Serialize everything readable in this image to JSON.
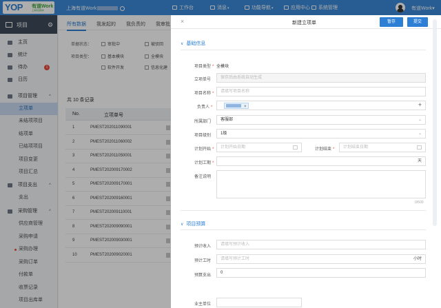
{
  "topbar": {
    "logo_text": "YOP",
    "logo_brand": "有道Work",
    "logo_sub": "上海有道软件",
    "company": "上海有道Work",
    "nav": [
      {
        "label": "工作台",
        "icon": "desktop-icon"
      },
      {
        "label": "消息",
        "icon": "bell-icon"
      },
      {
        "label": "功能导航",
        "icon": "grid-icon"
      },
      {
        "label": "应用中心",
        "icon": "apps-icon"
      },
      {
        "label": "系统管理",
        "icon": "gear-icon"
      }
    ],
    "username": "有道Work",
    "dropdown_glyph": "▾"
  },
  "sidebar": {
    "title": "项目",
    "items": [
      {
        "label": "主页",
        "icon": "home-icon"
      },
      {
        "label": "统计",
        "icon": "chart-icon"
      },
      {
        "label": "待办",
        "icon": "todo-icon",
        "badge": "1"
      },
      {
        "label": "日历",
        "icon": "calendar-icon"
      },
      {
        "label": "项目管理",
        "icon": "folder-icon",
        "caret": "^"
      },
      {
        "label": "立项单",
        "sub": true,
        "active": true
      },
      {
        "label": "未结项项目",
        "sub": true
      },
      {
        "label": "结项单",
        "sub": true
      },
      {
        "label": "已结项项目",
        "sub": true
      },
      {
        "label": "项目变更",
        "sub": true
      },
      {
        "label": "项目汇总",
        "sub": true
      },
      {
        "label": "项目支出",
        "icon": "money-icon",
        "caret": "^"
      },
      {
        "label": "支出",
        "sub": true
      },
      {
        "label": "采购管理",
        "icon": "cart-icon",
        "caret": "^"
      },
      {
        "label": "供应商管理",
        "sub": true
      },
      {
        "label": "采购申请",
        "sub": true
      },
      {
        "label": "采购办理",
        "sub": true,
        "dot": true
      },
      {
        "label": "采购订单",
        "sub": true
      },
      {
        "label": "付款单",
        "sub": true
      },
      {
        "label": "收票记录",
        "sub": true
      },
      {
        "label": "项目出库单",
        "sub": true
      }
    ]
  },
  "list": {
    "tabs": [
      "所有数据",
      "我发起的",
      "我负责的",
      "我审批"
    ],
    "filter_labels": [
      "单据状态：",
      "项目类型："
    ],
    "checkboxes": [
      "审批中",
      "被驳回",
      "基本模块",
      "全模块",
      "软件开发",
      "信息化建"
    ],
    "count": "共 10 条记录",
    "columns": [
      "No.",
      "立项单号"
    ],
    "rows": [
      [
        "1",
        "PMEST202011090001"
      ],
      [
        "2",
        "PMEST202011060002"
      ],
      [
        "3",
        "PMEST202011050001"
      ],
      [
        "4",
        "PMEST202009170002"
      ],
      [
        "5",
        "PMEST202009170001"
      ],
      [
        "6",
        "PMEST202009160001"
      ],
      [
        "7",
        "PMEST202009110001"
      ],
      [
        "8",
        "PMEST202009090001"
      ],
      [
        "9",
        "PMEST202009030001"
      ],
      [
        "10",
        "PMEST202009020001"
      ]
    ]
  },
  "panel": {
    "close_glyph": "×",
    "title": "新建立项单",
    "save_label": "暂存",
    "submit_label": "提交",
    "section_basic": "基础信息",
    "section_budget": "项目预算",
    "fields": {
      "type_label": "项目类型",
      "type_value": "全模块",
      "number_label": "立项单号",
      "number_placeholder": "保存后由系统自动生成",
      "name_label": "项目名称",
      "name_placeholder": "请填写项目名称",
      "owner_label": "负责人",
      "tag_close": "×",
      "add_glyph": "+",
      "dept_label": "所属部门",
      "dept_value": "客服部",
      "level_label": "项目级别",
      "level_value": "1级",
      "start_label": "计划开始",
      "start_placeholder": "计划开始日期",
      "end_label": "计划结束",
      "end_placeholder": "计划结束日期",
      "duration_label": "计划工期",
      "duration_unit": "天",
      "remark_label": "备注说明",
      "remark_counter": "0/500",
      "income_label": "预计收入",
      "income_placeholder": "请填写预计收入",
      "hours_label": "预计工时",
      "hours_placeholder": "请填写预计工时",
      "hours_unit": "小时",
      "expense_label": "预算支出",
      "expense_value": "0",
      "customer_label": "业主单位",
      "select_glyph": "⌄"
    }
  }
}
